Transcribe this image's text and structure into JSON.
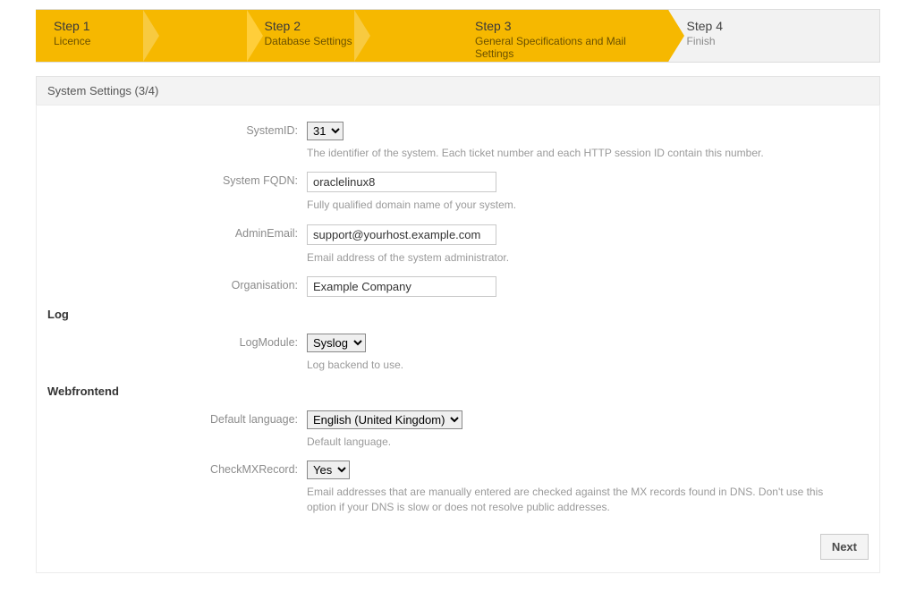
{
  "wizard": {
    "steps": [
      {
        "title": "Step 1",
        "sub": "Licence"
      },
      {
        "title": "Step 2",
        "sub": "Database Settings"
      },
      {
        "title": "Step 3",
        "sub": "General Specifications and Mail Settings"
      },
      {
        "title": "Step 4",
        "sub": "Finish"
      }
    ]
  },
  "panel_title": "System Settings (3/4)",
  "fields": {
    "system_id": {
      "label": "SystemID:",
      "value": "31",
      "help": "The identifier of the system. Each ticket number and each HTTP session ID contain this number."
    },
    "system_fqdn": {
      "label": "System FQDN:",
      "value": "oraclelinux8",
      "help": "Fully qualified domain name of your system."
    },
    "admin_email": {
      "label": "AdminEmail:",
      "value": "support@yourhost.example.com",
      "help": "Email address of the system administrator."
    },
    "organisation": {
      "label": "Organisation:",
      "value": "Example Company"
    },
    "log_section": "Log",
    "log_module": {
      "label": "LogModule:",
      "value": "Syslog",
      "help": "Log backend to use."
    },
    "webfrontend_section": "Webfrontend",
    "default_language": {
      "label": "Default language:",
      "value": "English (United Kingdom)",
      "help": "Default language."
    },
    "check_mx": {
      "label": "CheckMXRecord:",
      "value": "Yes",
      "help": "Email addresses that are manually entered are checked against the MX records found in DNS. Don't use this option if your DNS is slow or does not resolve public addresses."
    }
  },
  "next_label": "Next"
}
